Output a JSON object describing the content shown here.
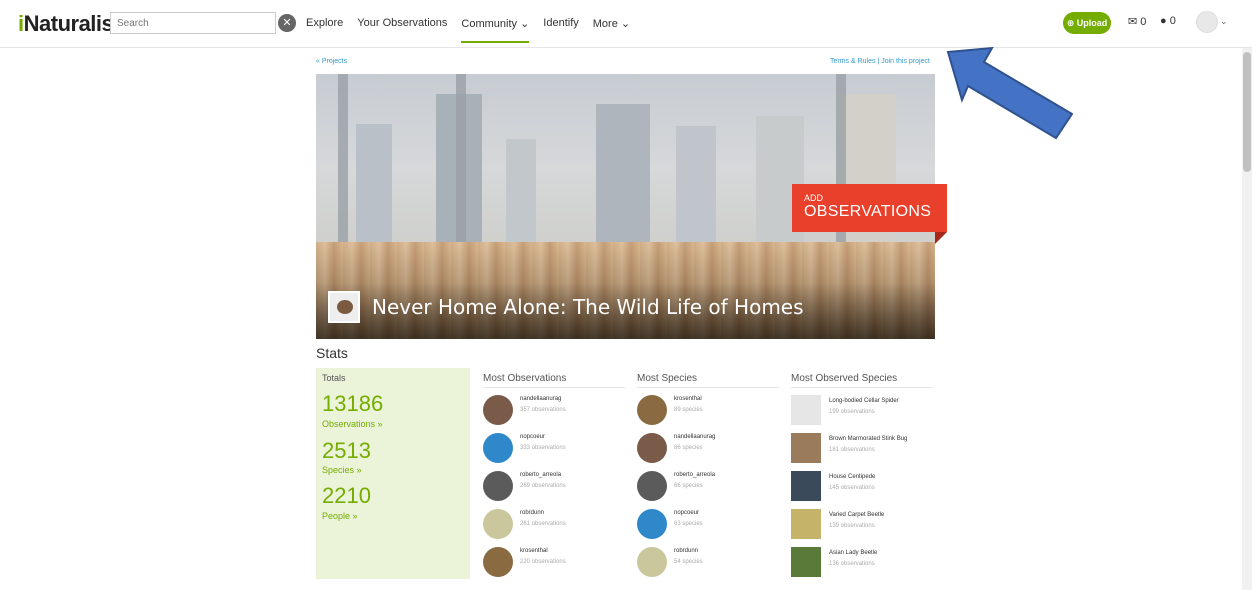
{
  "header": {
    "logo": "iNaturalist",
    "search_placeholder": "Search",
    "nav": [
      "Explore",
      "Your Observations",
      "Community",
      "Identify",
      "More"
    ],
    "upload_label": "Upload",
    "messages_count": "0",
    "notifications_count": "0"
  },
  "links": {
    "projects": "« Projects",
    "terms": "Terms & Rules",
    "join": "Join this project"
  },
  "banner": {
    "title": "Never Home Alone: The Wild Life of Homes",
    "add_line1": "ADD",
    "add_line2": "OBSERVATIONS"
  },
  "stats": {
    "title": "Stats",
    "totals_head": "Totals",
    "observations": "13186",
    "observations_label": "Observations »",
    "species": "2513",
    "species_label": "Species »",
    "people": "2210",
    "people_label": "People »"
  },
  "most_observations": {
    "heading": "Most Observations",
    "rows": [
      {
        "name": "nandellaanurag",
        "sub": "357 observations",
        "color": "#7a5a48"
      },
      {
        "name": "nopcoeur",
        "sub": "333 observations",
        "color": "#2f88c9"
      },
      {
        "name": "roberto_arreola",
        "sub": "269 observations",
        "color": "#5b5b5b"
      },
      {
        "name": "robrdunn",
        "sub": "261 observations",
        "color": "#c9c79b"
      },
      {
        "name": "krosenthal",
        "sub": "220 observations",
        "color": "#8a6a40"
      }
    ]
  },
  "most_species": {
    "heading": "Most Species",
    "rows": [
      {
        "name": "krosenthal",
        "sub": "89 species",
        "color": "#8a6a40"
      },
      {
        "name": "nandellaanurag",
        "sub": "86 species",
        "color": "#7a5a48"
      },
      {
        "name": "roberto_arreola",
        "sub": "66 species",
        "color": "#5b5b5b"
      },
      {
        "name": "nopcoeur",
        "sub": "63 species",
        "color": "#2f88c9"
      },
      {
        "name": "robrdunn",
        "sub": "54 species",
        "color": "#c9c79b"
      }
    ]
  },
  "most_observed_species": {
    "heading": "Most Observed Species",
    "rows": [
      {
        "name": "Long-bodied Cellar Spider",
        "sub": "199 observations",
        "color": "#e6e6e6"
      },
      {
        "name": "Brown Marmorated Stink Bug",
        "sub": "181 observations",
        "color": "#9a7c5c"
      },
      {
        "name": "House Centipede",
        "sub": "145 observations",
        "color": "#3b4a5a"
      },
      {
        "name": "Varied Carpet Beetle",
        "sub": "139 observations",
        "color": "#c6b36a"
      },
      {
        "name": "Asian Lady Beetle",
        "sub": "136 observations",
        "color": "#5a7a3a"
      }
    ]
  },
  "colors": {
    "brand_green": "#74ac00",
    "add_obs_red": "#e8402a",
    "arrow_blue": "#4472c4"
  }
}
